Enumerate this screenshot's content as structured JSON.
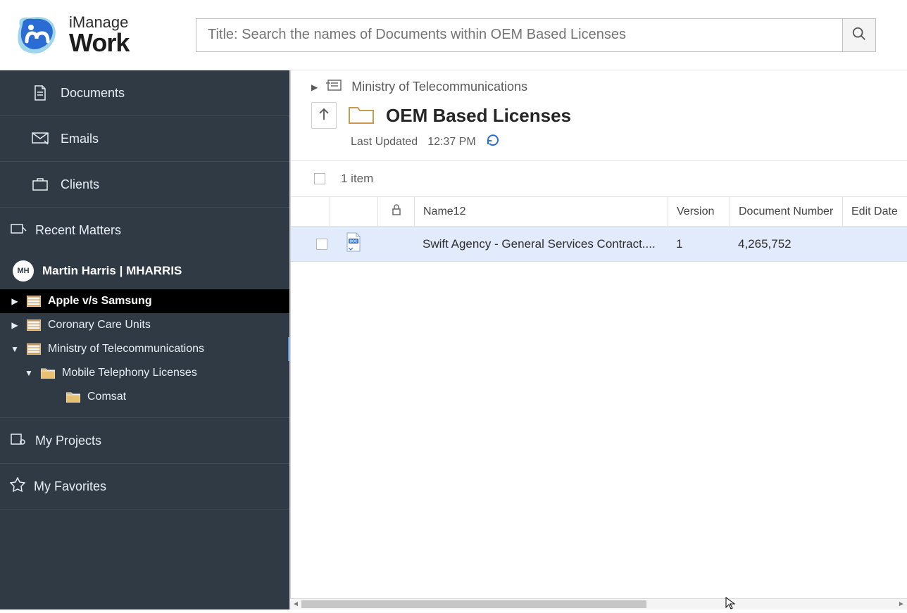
{
  "brand": {
    "top": "iManage",
    "bottom": "Work"
  },
  "search": {
    "placeholder": "Title: Search the names of Documents within OEM Based Licenses"
  },
  "sidebar": {
    "documents": "Documents",
    "emails": "Emails",
    "clients": "Clients",
    "recent": "Recent Matters",
    "projects": "My Projects",
    "favorites": "My Favorites",
    "user": {
      "initials": "MH",
      "display": "Martin Harris | MHARRIS"
    },
    "tree": {
      "apple": "Apple v/s Samsung",
      "coronary": "Coronary Care Units",
      "ministry": "Ministry of Telecommunications",
      "mobile": "Mobile Telephony Licenses",
      "comsat": "Comsat"
    }
  },
  "main": {
    "breadcrumb": "Ministry of Telecommunications",
    "title": "OEM Based Licenses",
    "updated_label": "Last Updated",
    "updated_time": "12:37 PM",
    "count": "1 item",
    "columns": {
      "name": "Name12",
      "version": "Version",
      "docnum": "Document Number",
      "edit": "Edit Date"
    },
    "rows": [
      {
        "name": "Swift Agency - General Services Contract....",
        "version": "1",
        "docnum": "4,265,752"
      }
    ]
  }
}
